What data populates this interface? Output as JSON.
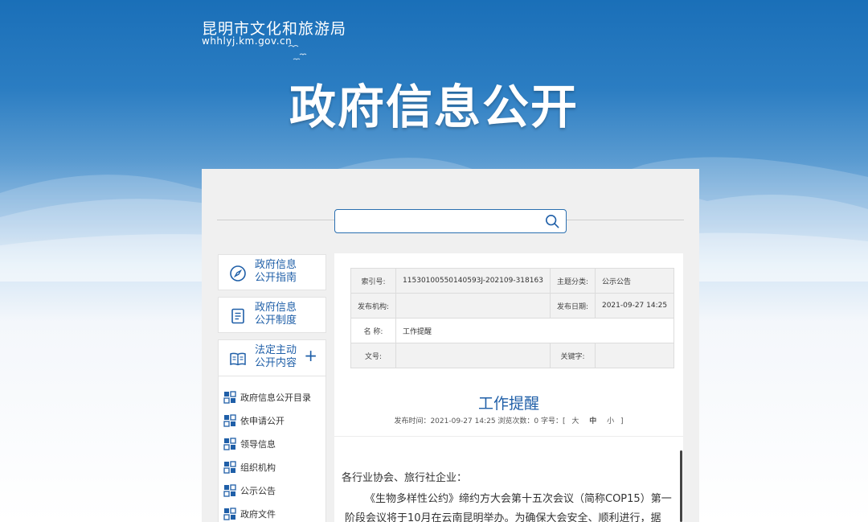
{
  "header": {
    "site_name": "昆明市文化和旅游局",
    "site_url": "whhlyj.km.gov.cn",
    "hero_title": "政府信息公开"
  },
  "search": {
    "placeholder": ""
  },
  "sidebar": {
    "cards": [
      {
        "label_line1": "政府信息",
        "label_line2": "公开指南",
        "icon": "compass-icon"
      },
      {
        "label_line1": "政府信息",
        "label_line2": "公开制度",
        "icon": "document-icon"
      },
      {
        "label_line1": "法定主动",
        "label_line2": "公开内容",
        "icon": "book-icon",
        "expand": "+"
      }
    ],
    "items": [
      {
        "label": "政府信息公开目录"
      },
      {
        "label": "依申请公开"
      },
      {
        "label": "领导信息"
      },
      {
        "label": "组织机构"
      },
      {
        "label": "公示公告"
      },
      {
        "label": "政府文件"
      }
    ]
  },
  "meta": {
    "index_label": "索引号:",
    "index_value": "11530100550140593J-202109-318163",
    "category_label": "主题分类:",
    "category_value": "公示公告",
    "org_label": "发布机构:",
    "org_value": "",
    "date_label": "发布日期:",
    "date_value": "2021-09-27 14:25",
    "name_label": "名 称:",
    "name_value": "工作提醒",
    "docno_label": "文号:",
    "docno_value": "",
    "keyword_label": "关键字:",
    "keyword_value": ""
  },
  "article": {
    "title": "工作提醒",
    "meta_text": "发布时间：2021-09-27 14:25 浏览次数：0 字号：[",
    "size_large": "大",
    "size_medium": "中",
    "size_small": "小",
    "meta_close": "]",
    "greeting": "各行业协会、旅行社企业：",
    "para1": "《生物多样性公约》缔约方大会第十五次会议（简称COP15）第一",
    "para2": "阶段会议将于10月在云南昆明举办。为确保大会安全、顺利进行，据"
  },
  "colors": {
    "accent": "#1f5fa8",
    "header_blue": "#1a6fb8"
  }
}
